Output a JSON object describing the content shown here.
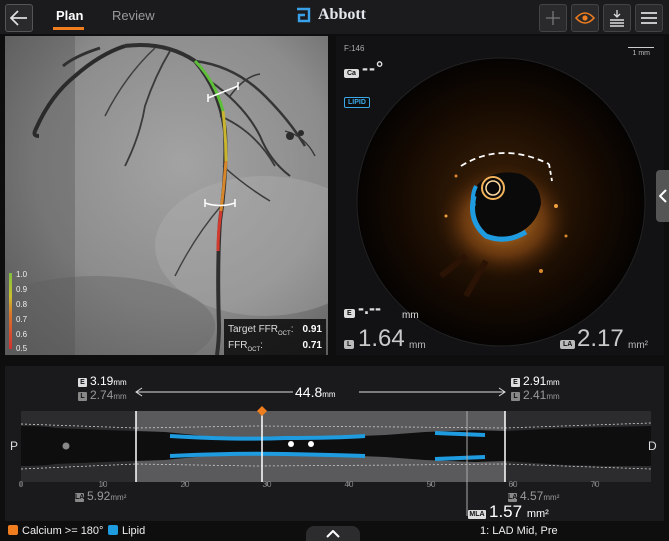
{
  "header": {
    "tabs": [
      {
        "label": "Plan",
        "active": true
      },
      {
        "label": "Review",
        "active": false
      }
    ],
    "brand": "Abbott",
    "icons": [
      "back-arrow-icon",
      "plus-icon",
      "eye-icon",
      "export-icon",
      "menu-icon"
    ],
    "accent_color": "#f07d1e"
  },
  "angio": {
    "legend": [
      "1.0",
      "0.9",
      "0.8",
      "0.7",
      "0.6",
      "0.5"
    ],
    "target_ffr_label": "Target FFR",
    "target_ffr_sub": "OCT",
    "target_ffr_value": "0.91",
    "ffr_label": "FFR",
    "ffr_sub": "OCT",
    "ffr_value": "0.71"
  },
  "oct": {
    "frame": "F:146",
    "scale": "1 mm",
    "ca_pill": "Ca",
    "ca_value": "--°",
    "lipid_pill": "LIPID",
    "e_pill": "E",
    "e_value": "-.--",
    "e_unit": "mm",
    "l_pill": "L",
    "l_value": "1.64",
    "l_unit": "mm",
    "la_pill": "LA",
    "la_value": "2.17",
    "la_unit": "mm²"
  },
  "longitudinal": {
    "left_e": "3.19",
    "left_l": "2.74",
    "right_e": "2.91",
    "right_l": "2.41",
    "length": "44.8",
    "unit": "mm",
    "left_area": "5.92",
    "right_area": "4.57",
    "area_unit": "mm²",
    "mla_pill": "MLA",
    "mla_value": "1.57",
    "mla_unit": "mm²",
    "proximal": "P",
    "distal": "D",
    "ticks": [
      "0",
      "10",
      "20",
      "30",
      "40",
      "50",
      "60",
      "70"
    ],
    "lipid_color": "#1f9be0"
  },
  "footer": {
    "calcium_label": "Calcium >= 180°",
    "lipid_label": "Lipid",
    "calcium_color": "#f07d1e",
    "lipid_color": "#1f9be0",
    "location": "1: LAD Mid, Pre"
  }
}
